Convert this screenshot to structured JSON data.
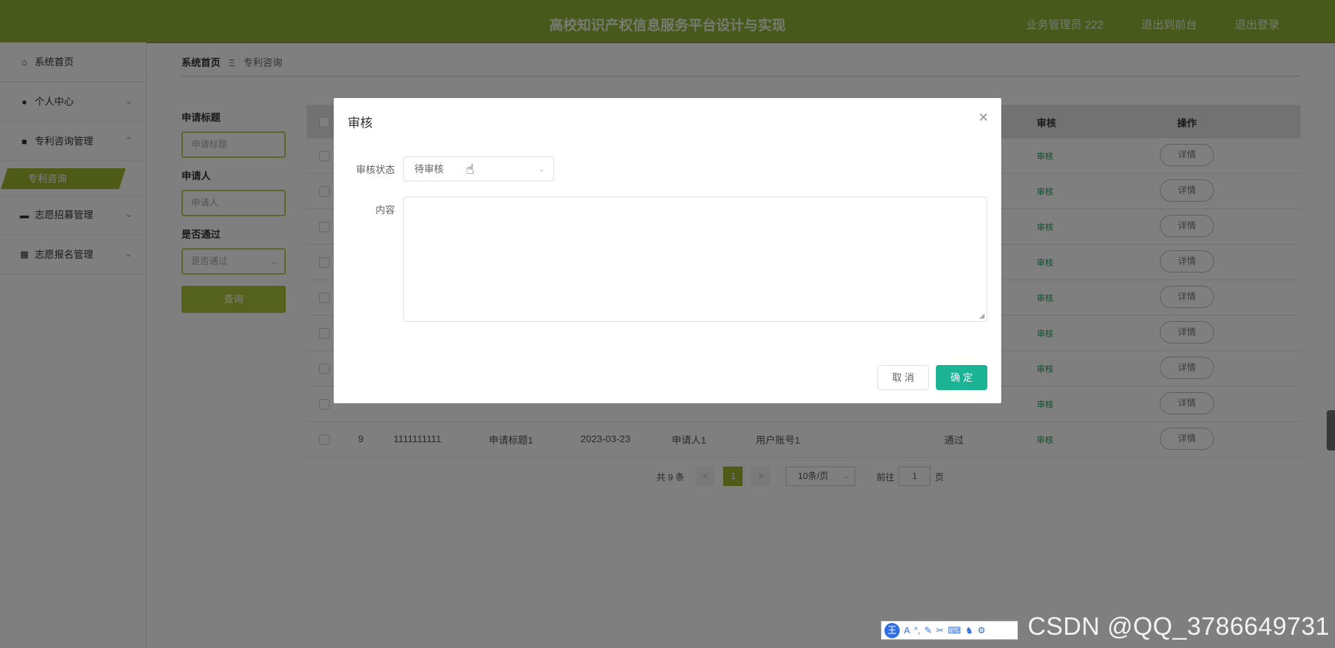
{
  "header": {
    "title": "高校知识产权信息服务平台设计与实现",
    "user": "业务管理员 222",
    "to_front": "退出到前台",
    "logout": "退出登录"
  },
  "sidebar": {
    "items": [
      {
        "label": "系统首页",
        "icon": "home-icon"
      },
      {
        "label": "个人中心",
        "icon": "user-icon"
      },
      {
        "label": "专利咨询管理",
        "icon": "briefcase-icon"
      },
      {
        "label": "志愿招募管理",
        "icon": "monitor-icon"
      },
      {
        "label": "志愿报名管理",
        "icon": "grid-icon"
      }
    ],
    "sub_active": "专利咨询"
  },
  "breadcrumb": {
    "home": "系统首页",
    "sep": "Ξ",
    "current": "专利咨询"
  },
  "filters": {
    "title_label": "申请标题",
    "title_placeholder": "申请标题",
    "applicant_label": "申请人",
    "applicant_placeholder": "申请人",
    "passed_label": "是否通过",
    "passed_placeholder": "是否通过",
    "query_button": "查询"
  },
  "table": {
    "headers": {
      "audit": "审核",
      "action": "操作"
    },
    "audit_link": "审核",
    "detail_button": "详情",
    "last_row": {
      "index": "9",
      "number": "1111111111",
      "title": "申请标题1",
      "date": "2023-03-23",
      "applicant": "申请人1",
      "account": "用户账号1",
      "status": "通过"
    }
  },
  "pager": {
    "total": "共 9 条",
    "prev": "<",
    "page": "1",
    "next": ">",
    "size": "10条/页",
    "goto_prefix": "前往",
    "goto_value": "1",
    "goto_suffix": "页"
  },
  "dialog": {
    "title": "审核",
    "status_label": "审核状态",
    "status_value": "待审核",
    "content_label": "内容",
    "cancel": "取 消",
    "ok": "确 定"
  },
  "ime": {
    "logo": "王",
    "letter": "A"
  },
  "watermark": "CSDN @QQ_3786649731"
}
